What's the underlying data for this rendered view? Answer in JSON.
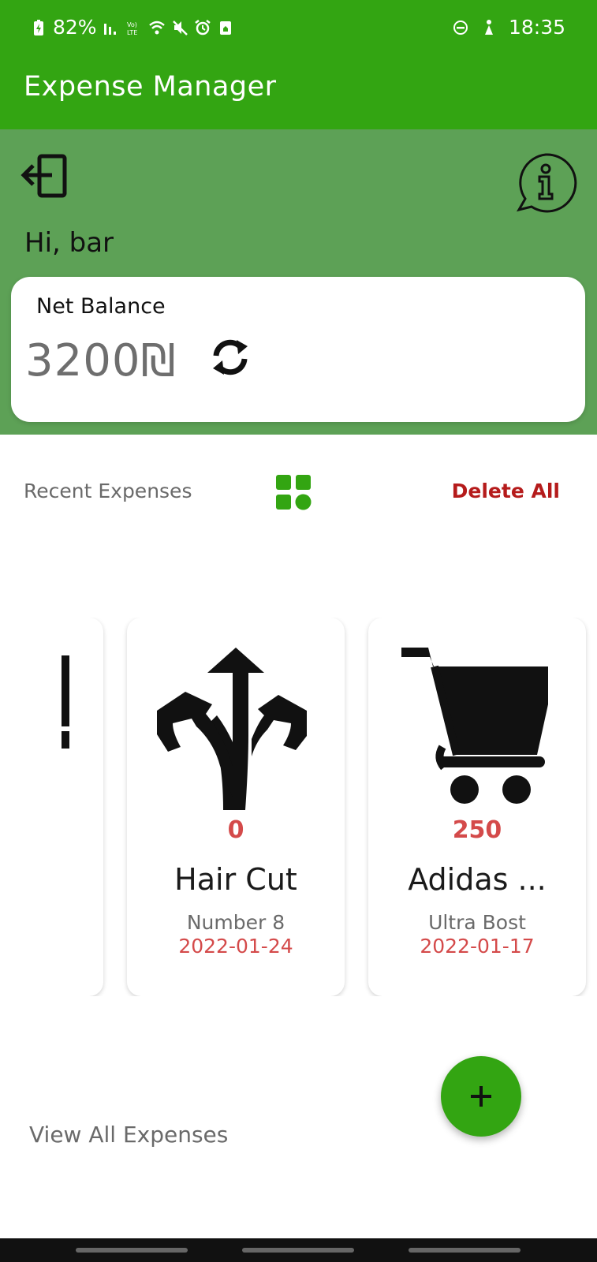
{
  "status": {
    "battery": "82%",
    "time": "18:35",
    "network_label": "VoLTE"
  },
  "app": {
    "title": "Expense Manager"
  },
  "header": {
    "greeting": "Hi, bar",
    "balance_label": "Net Balance",
    "balance_value": "3200₪"
  },
  "section": {
    "recent_label": "Recent Expenses",
    "delete_all": "Delete All"
  },
  "expenses": [
    {
      "amount": "0",
      "title": "Hair Cut",
      "subtitle": "Number 8",
      "date": "2022-01-24",
      "icon": "split-arrows-icon"
    },
    {
      "amount": "250",
      "title": "Adidas ...",
      "subtitle": "Ultra Bost",
      "date": "2022-01-17",
      "icon": "shopping-cart-icon"
    }
  ],
  "footer": {
    "view_all": "View All Expenses",
    "fab_label": "+"
  },
  "colors": {
    "primary": "#33a512",
    "header": "#5da156",
    "danger": "#b51b1b",
    "amount": "#d44a4a"
  }
}
